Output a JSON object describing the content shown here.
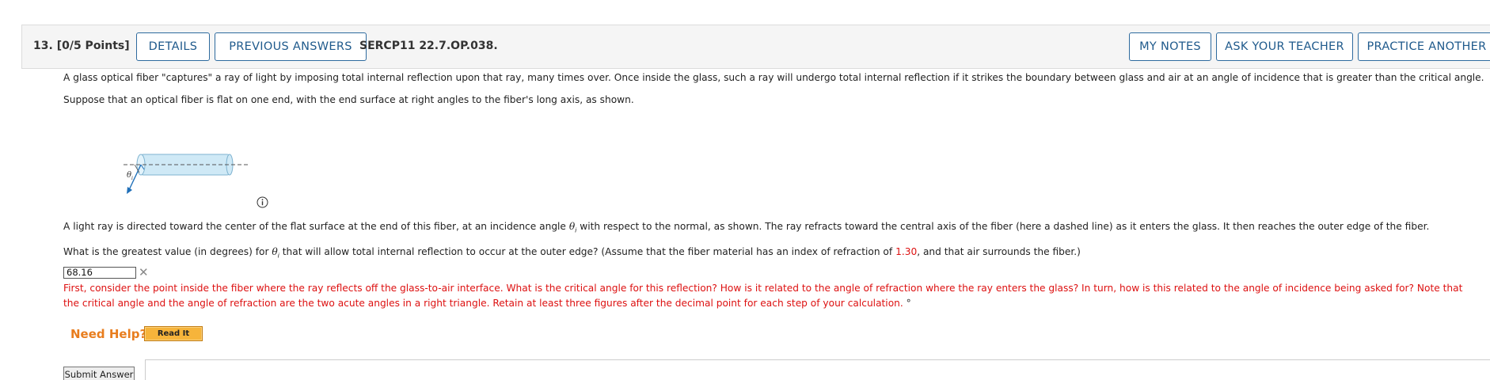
{
  "header": {
    "question_number": "13.",
    "points": "[0/5 Points]",
    "details_label": "DETAILS",
    "previous_answers_label": "PREVIOUS ANSWERS",
    "problem_code": "SERCP11 22.7.OP.038.",
    "my_notes_label": "MY NOTES",
    "ask_teacher_label": "ASK YOUR TEACHER",
    "practice_another_label": "PRACTICE ANOTHER"
  },
  "body": {
    "para1": "A glass optical fiber \"captures\" a ray of light by imposing total internal reflection upon that ray, many times over. Once inside the glass, such a ray will undergo total internal reflection if it strikes the boundary between glass and air at an angle of incidence that is greater than the critical angle.",
    "para2": "Suppose that an optical fiber is flat on one end, with the end surface at right angles to the fiber's long axis, as shown.",
    "para3_before": "A light ray is directed toward the center of the flat surface at the end of this fiber, at an incidence angle ",
    "para3_after": " with respect to the normal, as shown. The ray refracts toward the central axis of the fiber (here a dashed line) as it enters the glass. It then reaches the outer edge of the fiber.",
    "question_before": "What is the greatest value (in degrees) for ",
    "question_middle": " that will allow total internal reflection to occur at the outer edge? (Assume that the fiber material has an index of refraction of ",
    "index_value": "1.30",
    "question_after": ", and that air surrounds the fiber.)",
    "theta": "θ",
    "theta_sub": "i"
  },
  "answer": {
    "value": "68.16",
    "hint": "First, consider the point inside the fiber where the ray reflects off the glass-to-air interface. What is the critical angle for this reflection? How is it related to the angle of refraction where the ray enters the glass? In turn, how is this related to the angle of incidence being asked for? Note that the critical angle and the angle of refraction are the two acute angles in a right triangle. Retain at least three figures after the decimal point for each step of your calculation.",
    "degree_symbol": "°"
  },
  "help": {
    "need_help_label": "Need Help?",
    "read_it_label": "Read It"
  },
  "submit_label": "Submit Answer",
  "colors": {
    "button_border": "#2e6a9e",
    "button_text": "#1f5a8c",
    "feedback_red": "#dd1111",
    "need_help_orange": "#e87d1e",
    "read_it_bg": "#f6b43b"
  }
}
